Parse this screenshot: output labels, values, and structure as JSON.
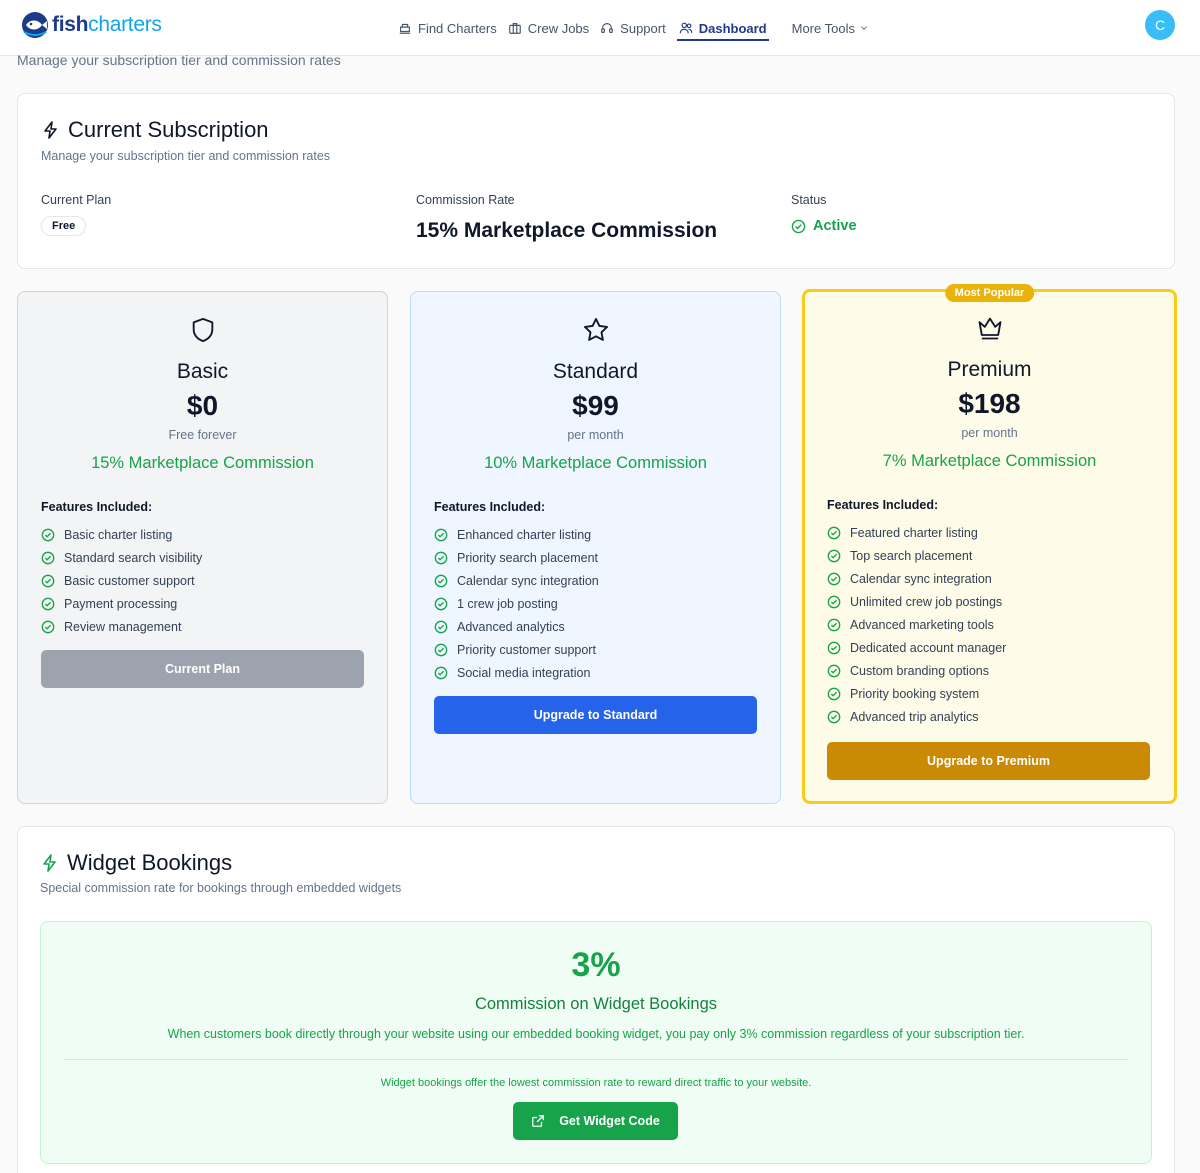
{
  "nav": {
    "logo": {
      "fish": "fish",
      "charters": "charters"
    },
    "links": [
      {
        "label": "Find Charters",
        "icon": "ship-icon"
      },
      {
        "label": "Crew Jobs",
        "icon": "briefcase-icon"
      },
      {
        "label": "Support",
        "icon": "headset-icon"
      },
      {
        "label": "Dashboard",
        "icon": "users-icon",
        "active": true
      }
    ],
    "more_tools": "More Tools",
    "avatar_initial": "C"
  },
  "page": {
    "subtitle": "Manage your subscription tier and commission rates"
  },
  "current_subscription": {
    "title": "Current Subscription",
    "subtitle": "Manage your subscription tier and commission rates",
    "current_plan_label": "Current Plan",
    "current_plan_value": "Free",
    "commission_label": "Commission Rate",
    "commission_value": "15% Marketplace Commission",
    "status_label": "Status",
    "status_value": "Active"
  },
  "plans": [
    {
      "id": "basic",
      "icon": "shield-icon",
      "name": "Basic",
      "price": "$0",
      "period": "Free forever",
      "commission": "15% Marketplace Commission",
      "features_title": "Features Included:",
      "features": [
        "Basic charter listing",
        "Standard search visibility",
        "Basic customer support",
        "Payment processing",
        "Review management"
      ],
      "button": "Current Plan"
    },
    {
      "id": "standard",
      "icon": "star-icon",
      "name": "Standard",
      "price": "$99",
      "period": "per month",
      "commission": "10% Marketplace Commission",
      "features_title": "Features Included:",
      "features": [
        "Enhanced charter listing",
        "Priority search placement",
        "Calendar sync integration",
        "1 crew job posting",
        "Advanced analytics",
        "Priority customer support",
        "Social media integration"
      ],
      "button": "Upgrade to Standard"
    },
    {
      "id": "premium",
      "icon": "crown-icon",
      "badge": "Most Popular",
      "name": "Premium",
      "price": "$198",
      "period": "per month",
      "commission": "7% Marketplace Commission",
      "features_title": "Features Included:",
      "features": [
        "Featured charter listing",
        "Top search placement",
        "Calendar sync integration",
        "Unlimited crew job postings",
        "Advanced marketing tools",
        "Dedicated account manager",
        "Custom branding options",
        "Priority booking system",
        "Advanced trip analytics"
      ],
      "button": "Upgrade to Premium"
    }
  ],
  "widget": {
    "title": "Widget Bookings",
    "subtitle": "Special commission rate for bookings through embedded widgets",
    "rate": "3%",
    "heading": "Commission on Widget Bookings",
    "description": "When customers book directly through your website using our embedded booking widget, you pay only 3% commission regardless of your subscription tier.",
    "note": "Widget bookings offer the lowest commission rate to reward direct traffic to your website.",
    "button": "Get Widget Code"
  },
  "colors": {
    "green": "#16a34a",
    "blue": "#2563eb",
    "gold": "#ca8a04",
    "navy": "#1e3a8a",
    "sky": "#0ea5e9"
  }
}
